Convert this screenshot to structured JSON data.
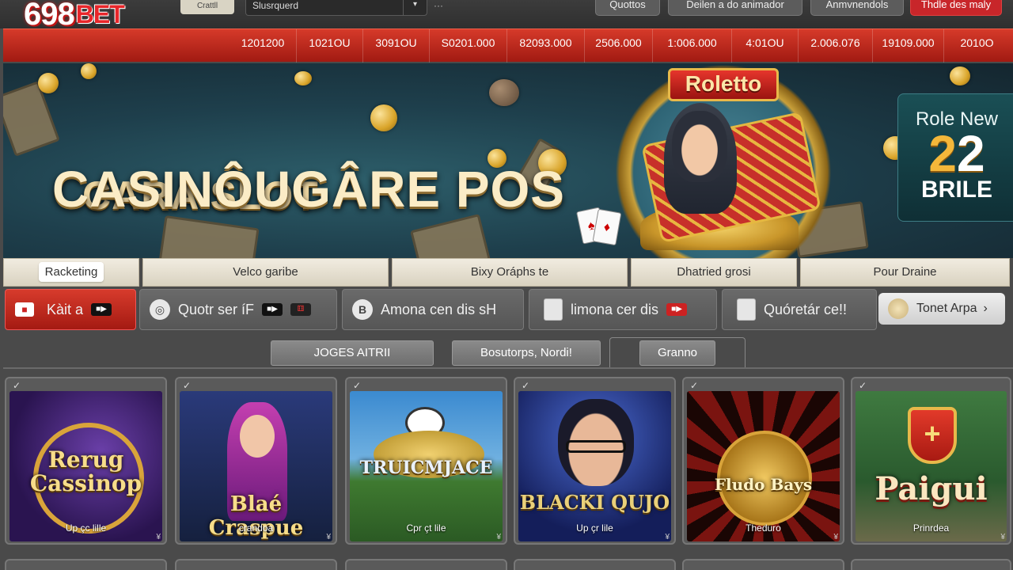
{
  "brand": {
    "number": "698",
    "suffix": "BET"
  },
  "topbar": {
    "chip_label": "Crattll",
    "search_value": "Slusrquerd",
    "search_caret": "▾",
    "buttons": [
      {
        "label": "Quottos"
      },
      {
        "label": "Deilen a do animador"
      },
      {
        "label": "Anmvnendols"
      },
      {
        "label": "Thdle des maly"
      }
    ]
  },
  "ticker": [
    "1201200",
    "1021OU",
    "3091OU",
    "S0201.000",
    "82093.000",
    "2506.000",
    "1:006.000",
    "4:01OU",
    "2.006.076",
    "19109.000",
    "2010O"
  ],
  "hero": {
    "line1": "CARA SLOT",
    "line2": "CASINÔUGÂRE POS",
    "sign": "Roletto",
    "promo": {
      "line1": "Role New",
      "number_a": "2",
      "number_b": "2",
      "line3": "BRILE"
    }
  },
  "categories": [
    {
      "label": "Racketing",
      "active": true
    },
    {
      "label": "Velco garibe",
      "active": false
    },
    {
      "label": "Bixy Oráphs te",
      "active": false
    },
    {
      "label": "Dhatried grosi",
      "active": false
    },
    {
      "label": "Pour Draine",
      "active": false
    }
  ],
  "filters": [
    {
      "label": "Kàit a"
    },
    {
      "label": "Quotr ser íF"
    },
    {
      "label": "Amona cen dis sH"
    },
    {
      "label": "limona cer dis"
    },
    {
      "label": "Quóretár ce!!"
    }
  ],
  "filter_extra": {
    "label": "Tonet Arpa",
    "arrow": "›"
  },
  "subtabs": [
    "JOGES AITRII",
    "Bosutorps, Nordi!",
    "Granno"
  ],
  "games": [
    {
      "title": "Rerug Cassinop",
      "sub": "Up çc lille",
      "colors": [
        "#3a1f6e",
        "#c2406a"
      ]
    },
    {
      "title": "Blaé Craspue",
      "sub": "crandoa",
      "colors": [
        "#1c2a5a",
        "#6a4aa0"
      ]
    },
    {
      "title": "TRUICMJACE",
      "sub": "Cpr çt lile",
      "colors": [
        "#2a6fa8",
        "#5da04a"
      ]
    },
    {
      "title": "BLACKI QUJO",
      "sub": "Up çr lile",
      "colors": [
        "#1c2f8a",
        "#4a6ad0"
      ]
    },
    {
      "title": "Fludo Bays",
      "sub": "Theduro",
      "colors": [
        "#5a0e0a",
        "#2a0806"
      ]
    },
    {
      "title": "Paigui",
      "sub": "Prinrdea",
      "colors": [
        "#2e6a3a",
        "#8abf60"
      ]
    }
  ]
}
